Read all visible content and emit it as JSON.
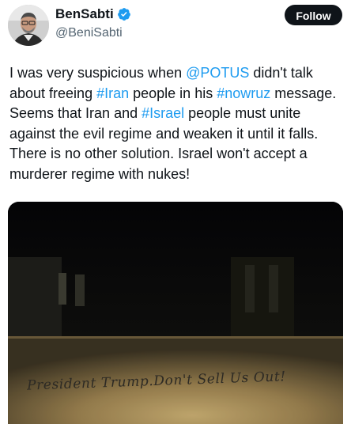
{
  "author": {
    "display_name": "BenSabti",
    "handle": "@BeniSabti",
    "verified": true,
    "avatar_icon": "profile-photo-icon"
  },
  "follow_button": {
    "label": "Follow"
  },
  "tweet": {
    "segments": [
      {
        "text": "I was very suspicious when ",
        "type": "text"
      },
      {
        "text": "@POTUS",
        "type": "mention"
      },
      {
        "text": " didn't talk about freeing ",
        "type": "text"
      },
      {
        "text": "#Iran",
        "type": "hashtag"
      },
      {
        "text": " people in his ",
        "type": "text"
      },
      {
        "text": "#nowruz",
        "type": "hashtag"
      },
      {
        "text": " message. Seems that Iran and ",
        "type": "text"
      },
      {
        "text": "#Israel",
        "type": "hashtag"
      },
      {
        "text": " people must unite against the evil regime and weaken it until it falls. There is no other solution. Israel won't accept a murderer regime with nukes!",
        "type": "text"
      }
    ]
  },
  "media": {
    "graffiti_text": "President Trump.Don't Sell Us Out!"
  },
  "colors": {
    "link": "#1d9bf0",
    "text": "#0f1419",
    "secondary": "#536471",
    "verified": "#1d9bf0",
    "button_bg": "#0f1419"
  }
}
